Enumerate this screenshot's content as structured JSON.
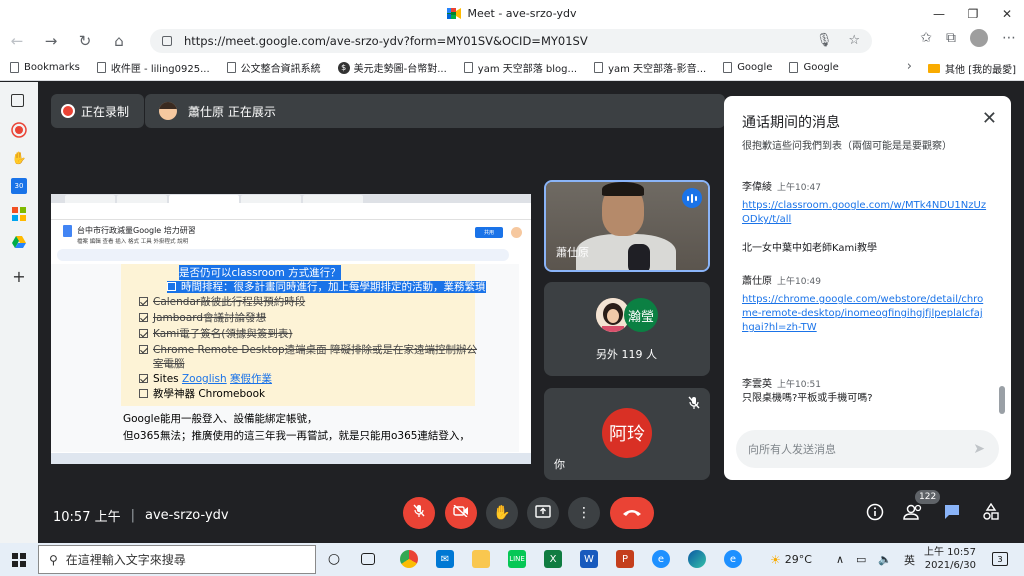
{
  "window": {
    "title": "Meet - ave-srzo-ydv"
  },
  "browser": {
    "url": "https://meet.google.com/ave-srzo-ydv?form=MY01SV&OCID=MY01SV",
    "bookmarks": [
      "Bookmarks",
      "收件匣 - liling0925...",
      "公文整合資訊系統",
      "美元走勢圖-台幣對...",
      "yam 天空部落 blog...",
      "yam 天空部落-影音...",
      "Google",
      "Google"
    ],
    "other_bookmarks": "其他 [我的最愛]"
  },
  "meet": {
    "recording_label": "正在录制",
    "presenting_label": "蕭仕原 正在展示",
    "meeting_time": "10:57 上午",
    "meeting_code": "ave-srzo-ydv",
    "participant_count": "122"
  },
  "shared_screen": {
    "doc_title": "台中市行政減量Google 培力研習",
    "menu_items": "檔案  編輯  查看  插入  格式  工具  外掛程式  說明",
    "share_label": "共用",
    "lines": [
      {
        "text": "是否仍可以classroom 方式進行？",
        "style": "highlight"
      },
      {
        "text": "時間排程：很多計畫同時進行，加上每學期排定的活動，業務繁瑣",
        "style": "highlight"
      },
      {
        "text": "Calendar敲彼此行程與預約時段",
        "style": "strike"
      },
      {
        "text": "Jamboard會議討論發想",
        "style": "strike"
      },
      {
        "text": "Kami電子簽名(領據與簽到表)",
        "style": "strike"
      },
      {
        "text": "Chrome Remote Desktop遠端桌面 障礙排除或是在家遠端控制辦公",
        "style": "strike"
      },
      {
        "text": "室電腦",
        "style": "strike"
      },
      {
        "text": "Sites",
        "style": "plain"
      },
      {
        "text": "Zooglish",
        "style": "link"
      },
      {
        "text": "寒假作業",
        "style": "link"
      },
      {
        "text": "教學神器 Chromebook",
        "style": "plain"
      },
      {
        "text": "Google能用一般登入、設備能綁定帳號，",
        "style": "body"
      },
      {
        "text": "但o365無法；推廣使用的這三年我一再嘗試，就是只能用o365連結登入，",
        "style": "body"
      }
    ]
  },
  "participants": {
    "presenter_name": "蕭仕原",
    "other_avatar_name": "瀚瑩",
    "others_count": "另外 119 人",
    "self_avatar": "阿玲",
    "self_label": "你"
  },
  "chat": {
    "title": "通话期间的消息",
    "top_fragment": "很抱歉這些问我們到表（兩個可能是是要觀察）",
    "messages": [
      {
        "sender": "李偉綾",
        "time": "上午10:47",
        "text": "https://classroom.google.com/w/MTk4NDU1NzUzODky/t/all",
        "is_link": true
      },
      {
        "sender": "",
        "time": "",
        "text": "北一女中葉中如老師Kami教學",
        "is_link": false
      },
      {
        "sender": "蕭仕原",
        "time": "上午10:49",
        "text": "https://chrome.google.com/webstore/detail/chrome-remote-desktop/inomeogfingihgjfjlpeplalcfajhgai?hl=zh-TW",
        "is_link": true
      },
      {
        "sender": "李雲英",
        "time": "上午10:51",
        "text": "只限桌機嗎?平板或手機可嗎?",
        "is_link": false
      }
    ],
    "input_placeholder": "向所有人发送消息"
  },
  "taskbar": {
    "search_placeholder": "在這裡輸入文字來搜尋",
    "weather": "29°C",
    "ime": "英",
    "time": "上午 10:57",
    "date": "2021/6/30",
    "notification_count": "3"
  },
  "colors": {
    "meet_bg": "#202124",
    "tile_bg": "#3c4043",
    "red": "#ea4335",
    "blue": "#1a73e8",
    "link": "#1a73e8"
  }
}
